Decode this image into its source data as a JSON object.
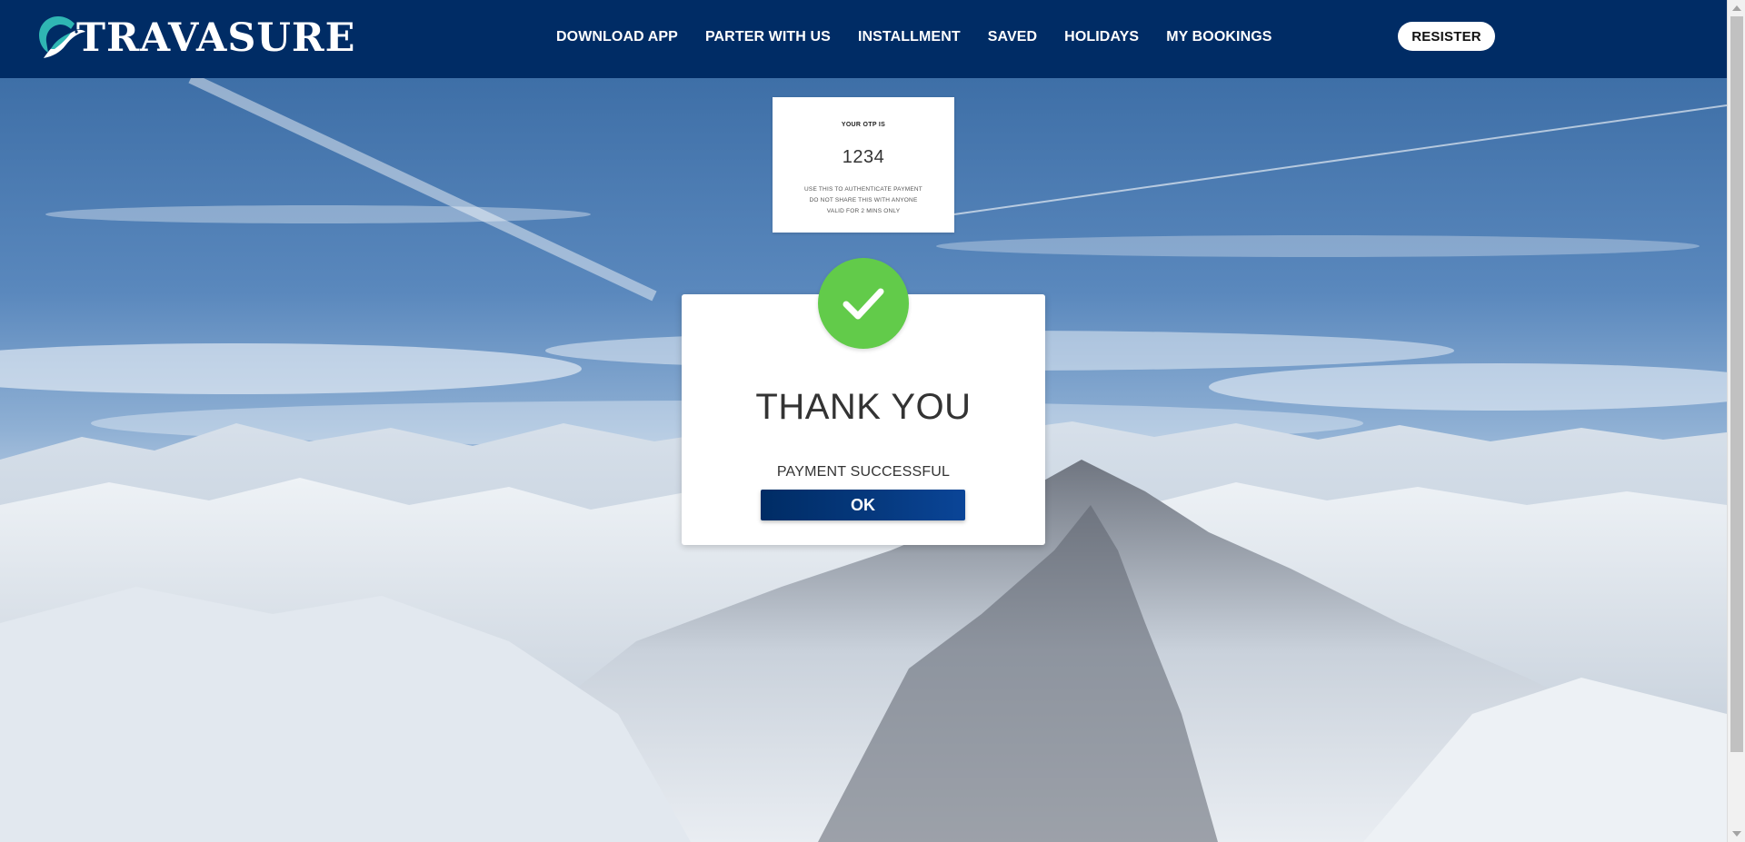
{
  "brand": {
    "name": "TRAVASURE"
  },
  "nav": {
    "items": [
      {
        "label": "DOWNLOAD APP"
      },
      {
        "label": "PARTER WITH US"
      },
      {
        "label": "INSTALLMENT"
      },
      {
        "label": "SAVED"
      },
      {
        "label": "HOLIDAYS"
      },
      {
        "label": "MY BOOKINGS"
      }
    ],
    "register_label": "RESISTER"
  },
  "otp": {
    "title": "YOUR OTP IS",
    "code": "1234",
    "notes": [
      "USE THIS TO AUTHENTICATE PAYMENT",
      "DO NOT SHARE THIS WITH ANYONE",
      "VALID FOR 2 MINS ONLY"
    ]
  },
  "success": {
    "icon": "check-icon",
    "heading": "THANK YOU",
    "status": "PAYMENT SUCCESSFUL",
    "ok_label": "OK"
  },
  "colors": {
    "navbar": "#002c65",
    "success_green": "#62cb4a",
    "button_blue": "#002c65",
    "logo_teal": "#2fb6b3"
  }
}
